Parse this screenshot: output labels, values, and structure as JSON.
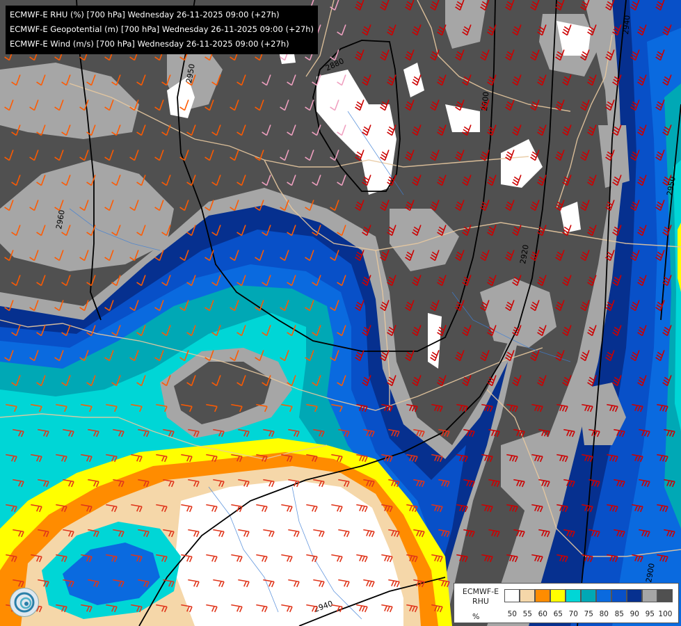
{
  "titles": [
    "ECMWF-E RHU (%) [700 hPa] Wednesday 26-11-2025 09:00 (+27h)",
    "ECMWF-E Geopotential (m) [700 hPa] Wednesday 26-11-2025 09:00 (+27h)",
    "ECMWF-E Wind (m/s) [700 hPa] Wednesday 26-11-2025 09:00 (+27h)"
  ],
  "legend": {
    "name_line1": "ECMWF-E",
    "name_line2": "RHU",
    "unit": "%",
    "ticks": [
      "50",
      "55",
      "60",
      "65",
      "70",
      "75",
      "80",
      "85",
      "90",
      "95",
      "100"
    ],
    "colors": [
      "#ffffff",
      "#f5d7a9",
      "#ff8c00",
      "#ffff00",
      "#00d6d6",
      "#00a8b5",
      "#0a6adf",
      "#0850c8",
      "#06308f",
      "#a6a6a6",
      "#505050"
    ]
  },
  "contour_labels": [
    "2880",
    "2900",
    "2920",
    "2940",
    "2940",
    "2950",
    "2950",
    "2960",
    "2900"
  ],
  "colors": {
    "rhu_100": "#505050",
    "rhu_95": "#a6a6a6",
    "rhu_90": "#06308f",
    "rhu_85": "#0850c8",
    "rhu_80": "#0a6adf",
    "rhu_75": "#00a8b5",
    "rhu_70": "#00d6d6",
    "rhu_65": "#ffff00",
    "rhu_60": "#ff8c00",
    "rhu_55": "#f5d7a9",
    "rhu_50": "#ffffff",
    "border": "#e8c9a0",
    "river": "#3f7fd6",
    "contour": "#000000"
  },
  "icons": {
    "logo": "ecmwf-logo-icon"
  }
}
